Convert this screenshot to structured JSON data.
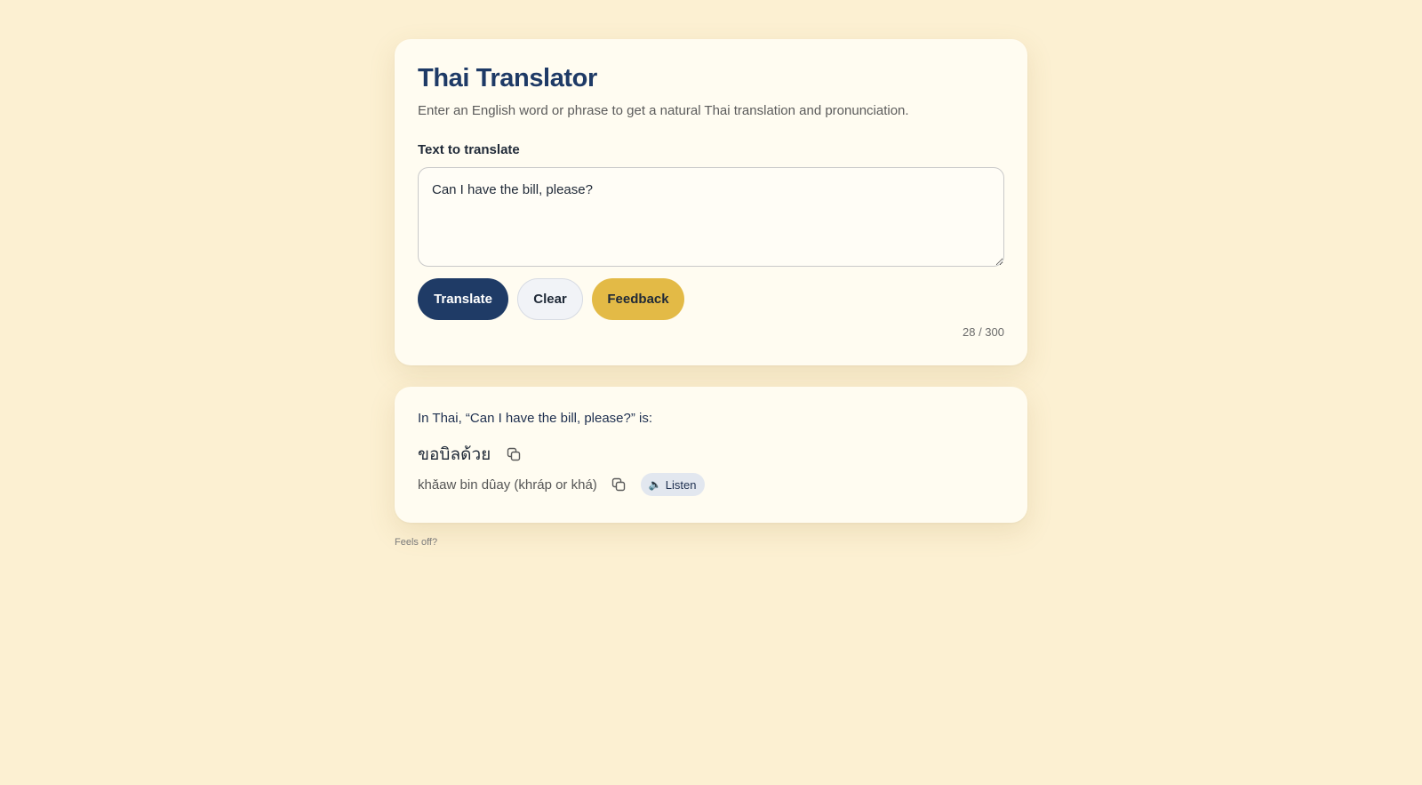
{
  "app": {
    "title": "Thai Translator",
    "subtitle": "Enter an English word or phrase to get a natural Thai translation and pronunciation."
  },
  "input": {
    "label": "Text to translate",
    "value": "Can I have the bill, please?",
    "counter": "28 / 300"
  },
  "buttons": {
    "translate": "Translate",
    "clear": "Clear",
    "feedback": "Feedback"
  },
  "result": {
    "intro": "In Thai, “Can I have the bill, please?” is:",
    "thai": "ขอบิลด้วย",
    "romanization": "khǎaw bin dûay (khráp or khá)",
    "listen_label": "Listen",
    "listen_icon": "🔈"
  },
  "footer": {
    "feels_off": "Feels off?"
  },
  "colors": {
    "background": "#fcf0d2",
    "card": "#fffcf1",
    "primary": "#1f3b66",
    "accent": "#e3ba46",
    "listen_bg": "#e2e7ef"
  }
}
